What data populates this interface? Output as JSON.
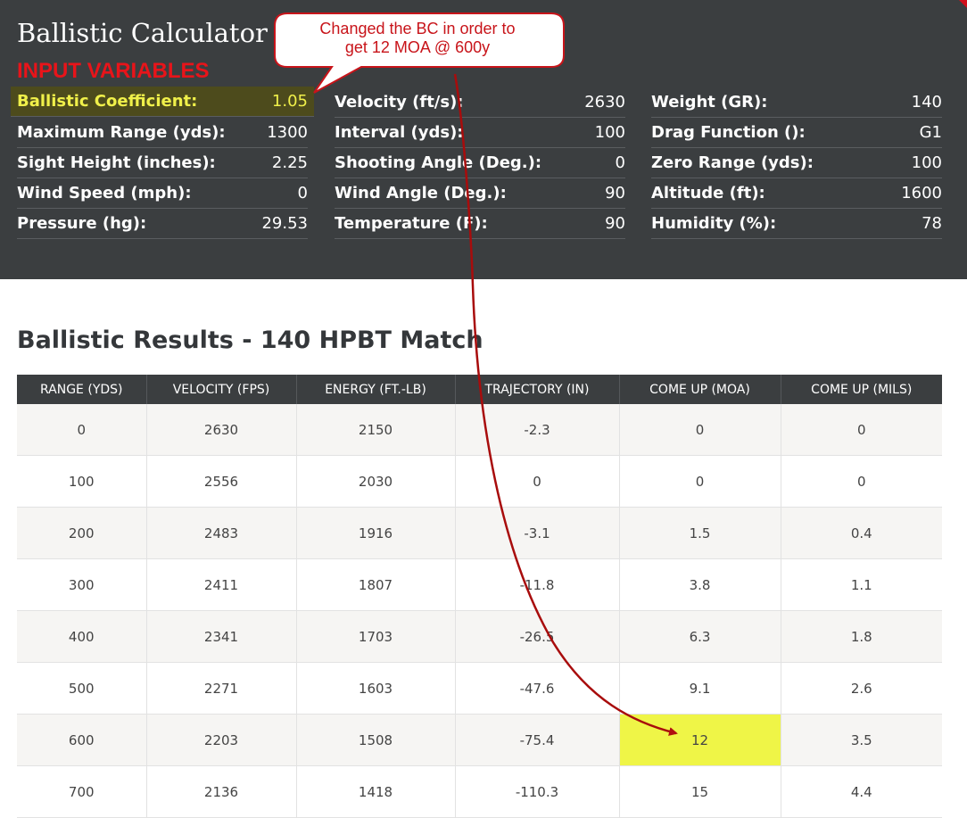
{
  "header": {
    "title": "Ballistic Calculator",
    "section_label": "INPUT VARIABLES"
  },
  "inputs": {
    "col1": [
      {
        "label": "Ballistic Coefficient:",
        "value": "1.05"
      },
      {
        "label": "Maximum Range (yds):",
        "value": "1300"
      },
      {
        "label": "Sight Height (inches):",
        "value": "2.25"
      },
      {
        "label": "Wind Speed (mph):",
        "value": "0"
      },
      {
        "label": "Pressure (hg):",
        "value": "29.53"
      }
    ],
    "col2": [
      {
        "label": "Velocity (ft/s):",
        "value": "2630"
      },
      {
        "label": "Interval (yds):",
        "value": "100"
      },
      {
        "label": "Shooting Angle (Deg.):",
        "value": "0"
      },
      {
        "label": "Wind Angle (Deg.):",
        "value": "90"
      },
      {
        "label": "Temperature (F):",
        "value": "90"
      }
    ],
    "col3": [
      {
        "label": "Weight (GR):",
        "value": "140"
      },
      {
        "label": "Drag Function ():",
        "value": "G1"
      },
      {
        "label": "Zero Range (yds):",
        "value": "100"
      },
      {
        "label": "Altitude (ft):",
        "value": "1600"
      },
      {
        "label": "Humidity (%):",
        "value": "78"
      }
    ]
  },
  "annotation": {
    "line1": "Changed the BC in order to",
    "line2": "get 12 MOA @ 600y",
    "color": "#c8141a",
    "highlight_color": "#eff547"
  },
  "results": {
    "title": "Ballistic Results - 140 HPBT Match",
    "columns": [
      "RANGE (YDS)",
      "VELOCITY (FPS)",
      "ENERGY (FT.-LB)",
      "TRAJECTORY (IN)",
      "COME UP (MOA)",
      "COME UP (MILS)"
    ],
    "rows": [
      [
        "0",
        "2630",
        "2150",
        "-2.3",
        "0",
        "0"
      ],
      [
        "100",
        "2556",
        "2030",
        "0",
        "0",
        "0"
      ],
      [
        "200",
        "2483",
        "1916",
        "-3.1",
        "1.5",
        "0.4"
      ],
      [
        "300",
        "2411",
        "1807",
        "-11.8",
        "3.8",
        "1.1"
      ],
      [
        "400",
        "2341",
        "1703",
        "-26.5",
        "6.3",
        "1.8"
      ],
      [
        "500",
        "2271",
        "1603",
        "-47.6",
        "9.1",
        "2.6"
      ],
      [
        "600",
        "2203",
        "1508",
        "-75.4",
        "12",
        "3.5"
      ],
      [
        "700",
        "2136",
        "1418",
        "-110.3",
        "15",
        "4.4"
      ]
    ]
  },
  "colors": {
    "panel": "#3b3e40",
    "accent_red": "#e8141a",
    "bc_highlight_text": "#f0f04a"
  }
}
